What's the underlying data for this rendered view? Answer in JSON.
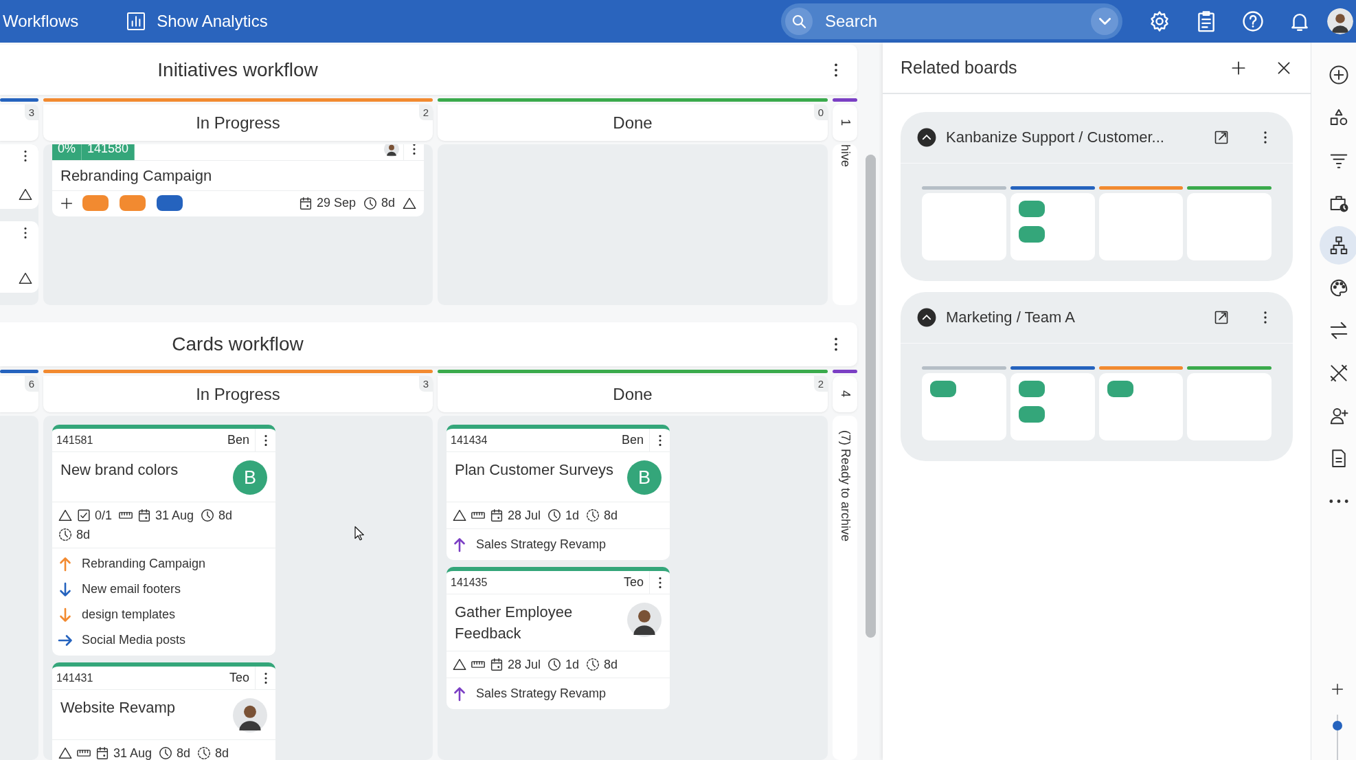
{
  "top_bar": {
    "title": "Workflows",
    "analytics_button": "Show Analytics",
    "search": {
      "placeholder": "Search"
    }
  },
  "workflows": [
    {
      "title": "Initiatives workflow",
      "columns": [
        {
          "kind": "clipped",
          "count": "3",
          "color": "#2563be",
          "cards": [
            {
              "kind": "stub"
            },
            {
              "kind": "stub"
            }
          ]
        },
        {
          "kind": "full",
          "title": "In Progress",
          "count": "2",
          "color": "#f28a30",
          "cards": [
            {
              "kind": "initiative",
              "progress": "0%",
              "id": "141580",
              "title": "Rebranding Campaign",
              "tags": [
                {
                  "color": "#f28a30"
                },
                {
                  "color": "#f28a30"
                },
                {
                  "color": "#2563be"
                }
              ],
              "meta": [
                {
                  "kind": "deadline",
                  "text": "29 Sep"
                },
                {
                  "kind": "cycle",
                  "text": "8d"
                },
                {
                  "kind": "blocked"
                }
              ]
            }
          ]
        },
        {
          "kind": "full",
          "title": "Done",
          "count": "0",
          "color": "#3aaa4c"
        }
      ],
      "archive": {
        "count": "1",
        "label": "hive",
        "color": "#7b3fc4"
      }
    },
    {
      "title": "Cards workflow",
      "columns": [
        {
          "kind": "clipped",
          "count": "6",
          "color": "#2563be"
        },
        {
          "kind": "full",
          "title": "In Progress",
          "count": "3",
          "color": "#f28a30",
          "cards": [
            {
              "kind": "task",
              "id": "141581",
              "owner": "Ben",
              "title": "New brand colors",
              "avatar": {
                "kind": "letter",
                "text": "B"
              },
              "meta": [
                {
                  "kind": "blocked"
                },
                {
                  "kind": "checklist",
                  "text": "0/1"
                },
                {
                  "kind": "size"
                },
                {
                  "kind": "deadline",
                  "text": "31 Aug"
                },
                {
                  "kind": "cycle",
                  "text": "8d"
                },
                {
                  "kind": "logged",
                  "text": "8d"
                }
              ],
              "links": [
                {
                  "kind": "parent",
                  "text": "Rebranding Campaign",
                  "color": "#f28a30"
                },
                {
                  "kind": "child",
                  "text": "New email footers",
                  "color": "#2563be"
                },
                {
                  "kind": "child",
                  "text": "design templates",
                  "color": "#f28a30"
                },
                {
                  "kind": "relative",
                  "text": "Social Media posts",
                  "color": "#2563be"
                }
              ]
            },
            {
              "kind": "task",
              "id": "141431",
              "owner": "Teo",
              "title": "Website Revamp",
              "avatar": {
                "kind": "photo"
              },
              "meta": [
                {
                  "kind": "blocked"
                },
                {
                  "kind": "size"
                },
                {
                  "kind": "deadline",
                  "text": "31 Aug"
                },
                {
                  "kind": "cycle",
                  "text": "8d"
                },
                {
                  "kind": "logged",
                  "text": "8d"
                }
              ]
            }
          ]
        },
        {
          "kind": "full",
          "title": "Done",
          "count": "2",
          "color": "#3aaa4c",
          "cards": [
            {
              "kind": "task",
              "id": "141434",
              "owner": "Ben",
              "title": "Plan Customer Surveys",
              "avatar": {
                "kind": "letter",
                "text": "B"
              },
              "meta": [
                {
                  "kind": "blocked"
                },
                {
                  "kind": "size"
                },
                {
                  "kind": "deadline",
                  "text": "28 Jul"
                },
                {
                  "kind": "cycle",
                  "text": "1d"
                },
                {
                  "kind": "logged",
                  "text": "8d"
                }
              ],
              "links": [
                {
                  "kind": "parent",
                  "text": "Sales Strategy Revamp",
                  "color": "#7b3fc4"
                }
              ]
            },
            {
              "kind": "task",
              "id": "141435",
              "owner": "Teo",
              "title": "Gather Employee Feedback",
              "avatar": {
                "kind": "photo"
              },
              "meta": [
                {
                  "kind": "blocked"
                },
                {
                  "kind": "size"
                },
                {
                  "kind": "deadline",
                  "text": "28 Jul"
                },
                {
                  "kind": "cycle",
                  "text": "1d"
                },
                {
                  "kind": "logged",
                  "text": "8d"
                }
              ],
              "links": [
                {
                  "kind": "parent",
                  "text": "Sales Strategy Revamp",
                  "color": "#7b3fc4"
                }
              ]
            }
          ]
        }
      ],
      "archive": {
        "count": "4",
        "label": "(7) Ready to archive",
        "color": "#7b3fc4"
      }
    }
  ],
  "related_boards": {
    "title": "Related boards",
    "boards": [
      {
        "title": "Kanbanize Support / Customer...",
        "expanded": true,
        "columns": [
          {
            "color": "#b5bec6"
          },
          {
            "color": "#2563be",
            "cards": [
              {
                "kind": "card"
              },
              {
                "kind": "card"
              }
            ]
          },
          {
            "color": "#f28a30"
          },
          {
            "color": "#3aaa4c"
          }
        ]
      },
      {
        "title": "Marketing / Team A",
        "expanded": true,
        "columns": [
          {
            "color": "#b5bec6",
            "cards": [
              {
                "kind": "card"
              }
            ]
          },
          {
            "color": "#2563be",
            "cards": [
              {
                "kind": "card"
              },
              {
                "kind": "card"
              }
            ]
          },
          {
            "color": "#f28a30",
            "cards": [
              {
                "kind": "card"
              }
            ]
          },
          {
            "color": "#3aaa4c"
          }
        ]
      }
    ]
  },
  "tool_rail": [
    {
      "kind": "add",
      "selected": false
    },
    {
      "kind": "shapes",
      "selected": false
    },
    {
      "kind": "filter",
      "selected": false
    },
    {
      "kind": "briefcase",
      "selected": false
    },
    {
      "kind": "hierarchy",
      "selected": true
    },
    {
      "kind": "palette",
      "selected": false
    },
    {
      "kind": "swap",
      "selected": false
    },
    {
      "kind": "tools",
      "selected": false
    },
    {
      "kind": "add_user",
      "selected": false
    },
    {
      "kind": "document",
      "selected": false
    },
    {
      "kind": "more",
      "selected": false
    }
  ],
  "zoom_slider": {
    "level": 0.85
  }
}
